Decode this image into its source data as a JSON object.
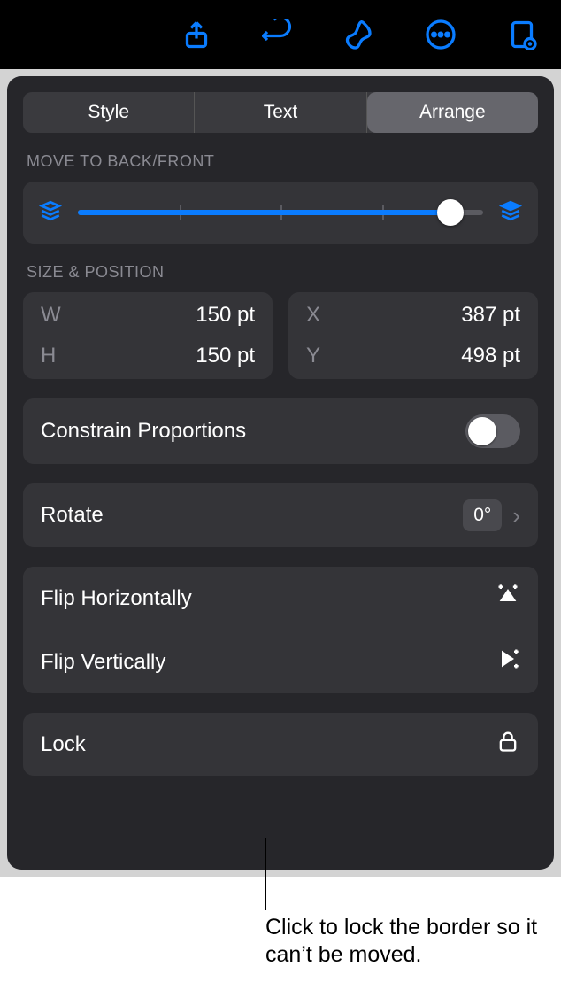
{
  "tabs": {
    "style": "Style",
    "text": "Text",
    "arrange": "Arrange"
  },
  "sections": {
    "move": "MOVE TO BACK/FRONT",
    "sizepos": "SIZE & POSITION"
  },
  "size_position": {
    "w_key": "W",
    "w_val": "150 pt",
    "h_key": "H",
    "h_val": "150 pt",
    "x_key": "X",
    "x_val": "387 pt",
    "y_key": "Y",
    "y_val": "498 pt"
  },
  "rows": {
    "constrain": "Constrain Proportions",
    "rotate": "Rotate",
    "rotate_val": "0°",
    "flip_h": "Flip Horizontally",
    "flip_v": "Flip Vertically",
    "lock": "Lock"
  },
  "callout": "Click to lock the border so it can’t be moved."
}
